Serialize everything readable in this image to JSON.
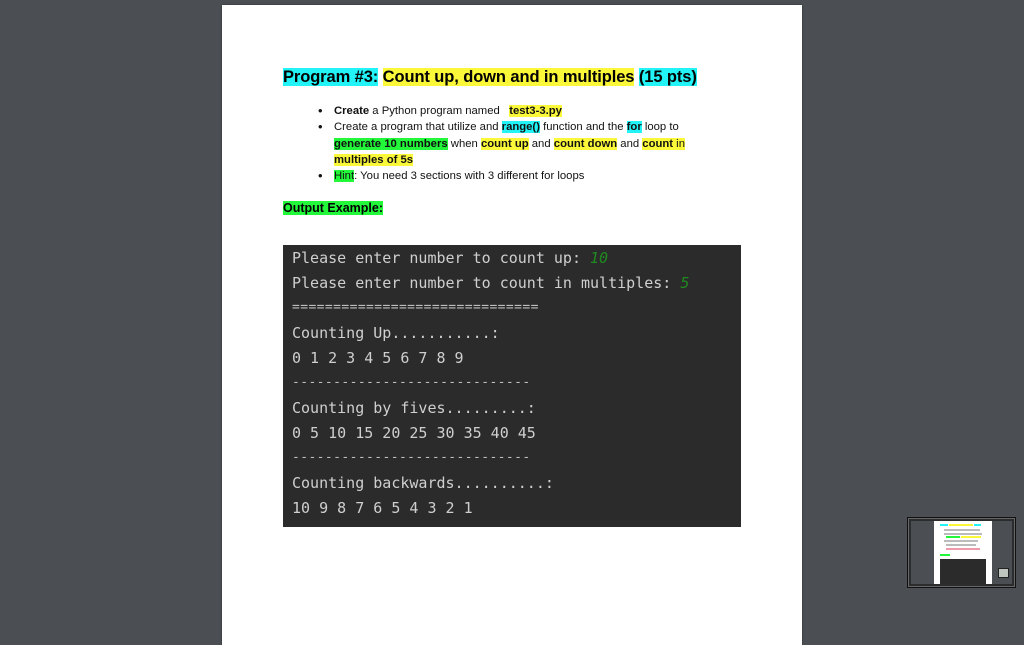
{
  "document": {
    "title": {
      "part1": "Program #3:",
      "part2": "Count up, down and in multiples",
      "part3": "(15 pts)"
    },
    "bullets": [
      {
        "create_bold": "Create",
        "text": " a Python program named ",
        "filename": "test3-3.py"
      },
      {
        "t1": "Create a program that utilize and ",
        "range": "range()",
        "t2": " function and the ",
        "for": "for",
        "t3": " loop to ",
        "generate": "generate 10 numbers",
        "t4": " when ",
        "count_up": "count up",
        "t5": " and ",
        "count_down": "count down",
        "t6": " and ",
        "count": "count",
        "t7": " in ",
        "multiples": "multiples of 5s"
      },
      {
        "hint": "Hint",
        "text": ": You need 3 sections with 3 different for loops"
      }
    ],
    "output_label": "Output Example:"
  },
  "console": {
    "lines": [
      {
        "text": "Please enter number to count up: ",
        "input": "10"
      },
      {
        "text": "Please enter number to count in multiples: ",
        "input": "5"
      },
      {
        "text": "=============================="
      },
      {
        "text": "Counting Up...........:"
      },
      {
        "text": "0 1 2 3 4 5 6 7 8 9"
      },
      {
        "text": "-----------------------------"
      },
      {
        "text": "Counting by fives.........:"
      },
      {
        "text": "0 5 10 15 20 25 30 35 40 45"
      },
      {
        "text": "-----------------------------"
      },
      {
        "text": "Counting backwards..........:"
      },
      {
        "text": "10 9 8 7 6 5 4 3 2 1"
      }
    ]
  },
  "colors": {
    "highlight_cyan": "#22f3f6",
    "highlight_yellow": "#fbf83a",
    "highlight_green": "#22f73a",
    "console_bg": "#2b2b2b",
    "input_green": "#1f8a1f"
  }
}
